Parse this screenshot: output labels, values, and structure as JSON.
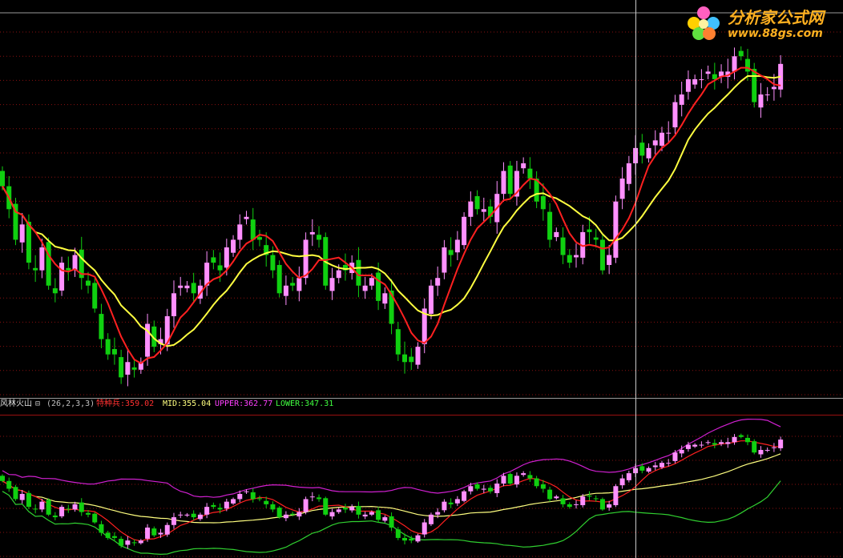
{
  "logo": {
    "title": "分析家公式网",
    "url": "www.88gs.com"
  },
  "indicator": {
    "name": "风林火山",
    "params": "(26,2,3,3)",
    "toggle": "⊟",
    "values": [
      {
        "label": "特种兵:",
        "value": "359.02",
        "color": "#ff3030"
      },
      {
        "label": "MID:",
        "value": "355.04",
        "color": "#ffff80"
      },
      {
        "label": "UPPER:",
        "value": "362.77",
        "color": "#ff40ff"
      },
      {
        "label": "LOWER:",
        "value": "347.31",
        "color": "#40ff40"
      }
    ]
  },
  "colors": {
    "up": "#ff90ff",
    "down": "#10d010",
    "grid": "#8a1010",
    "ma_fast": "#ff2020",
    "ma_slow": "#ffff40",
    "upper": "#d020d0",
    "mid": "#ffff80",
    "lower": "#30d030"
  },
  "chart_data": {
    "type": "candlestick",
    "close": [
      358,
      355,
      351,
      353,
      348,
      347,
      350,
      345,
      344,
      348,
      347,
      349,
      346,
      345,
      342,
      338,
      336,
      336,
      333,
      335,
      334,
      335,
      340,
      337,
      338,
      341,
      344,
      345,
      345,
      344,
      345,
      348,
      348,
      347,
      350,
      351,
      353,
      354,
      351,
      351,
      349,
      347,
      344,
      345,
      345,
      346,
      351,
      352,
      351,
      345,
      346,
      347,
      347,
      348,
      345,
      345,
      346,
      343,
      344,
      340,
      336,
      335,
      335,
      337,
      342,
      345,
      346,
      350,
      349,
      351,
      354,
      356,
      355,
      355,
      354,
      357,
      360,
      357,
      360,
      361,
      359,
      356,
      355,
      351,
      352,
      349,
      348,
      349,
      352,
      352,
      351,
      347,
      349,
      356,
      359,
      361,
      363,
      362,
      363,
      364,
      365,
      365,
      369,
      370,
      372,
      372,
      372,
      373,
      372,
      373,
      373,
      375,
      375,
      373,
      369,
      370,
      370,
      371,
      374
    ]
  },
  "chart_data_bollinger": {
    "type": "line",
    "series": [
      {
        "name": "UPPER",
        "value_last": 362.77
      },
      {
        "name": "MID",
        "value_last": 355.04
      },
      {
        "name": "LOWER",
        "value_last": 347.31
      }
    ]
  }
}
